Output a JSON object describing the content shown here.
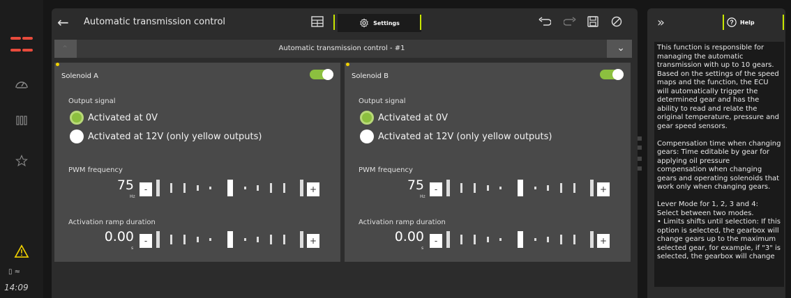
{
  "sidebar": {
    "time": "14:09",
    "icons": [
      "apps-grid-icon",
      "gauge-icon",
      "columns-icon",
      "star-icon",
      "warning-icon"
    ]
  },
  "header": {
    "title": "Automatic transmission control",
    "settings_label": "Settings"
  },
  "dropdown": {
    "selected": "Automatic transmission control - #1"
  },
  "cards": [
    {
      "title": "Solenoid A",
      "enabled": true,
      "output_signal_label": "Output signal",
      "options": [
        "Activated at 0V",
        "Activated at 12V (only yellow outputs)"
      ],
      "selected_option": 0,
      "pwm_label": "PWM frequency",
      "pwm_value": "75",
      "pwm_unit": "Hz",
      "ramp_label": "Activation ramp duration",
      "ramp_value": "0.00",
      "ramp_unit": "s",
      "minus": "-",
      "plus": "+"
    },
    {
      "title": "Solenoid B",
      "enabled": true,
      "output_signal_label": "Output signal",
      "options": [
        "Activated at 0V",
        "Activated at 12V (only yellow outputs)"
      ],
      "selected_option": 0,
      "pwm_label": "PWM frequency",
      "pwm_value": "75",
      "pwm_unit": "Hz",
      "ramp_label": "Activation ramp duration",
      "ramp_value": "0.00",
      "ramp_unit": "s",
      "minus": "-",
      "plus": "+"
    }
  ],
  "help": {
    "label": "Help",
    "text": "This function is responsible for managing the automatic transmission with up to 10 gears. Based on the settings of the speed maps and the function, the ECU will automatically trigger the determined gear and has the ability to read and relate the original temperature, pressure and gear speed sensors.\n\nCompensation time when changing gears: Time editable by gear for applying oil pressure compensation when changing gears and operating solenoids that work only when changing gears.\n\nLever Mode for 1, 2, 3 and 4: Select between two modes.\n• Limits shifts until selection: If this option is selected, the gearbox will change gears up to the maximum selected gear, for example, if \"3\" is selected, the gearbox will change"
  },
  "colors": {
    "accent": "#c8e600",
    "toggle_on": "#8cbf3f",
    "alert": "#e84b3c",
    "warning": "#f0d000"
  }
}
